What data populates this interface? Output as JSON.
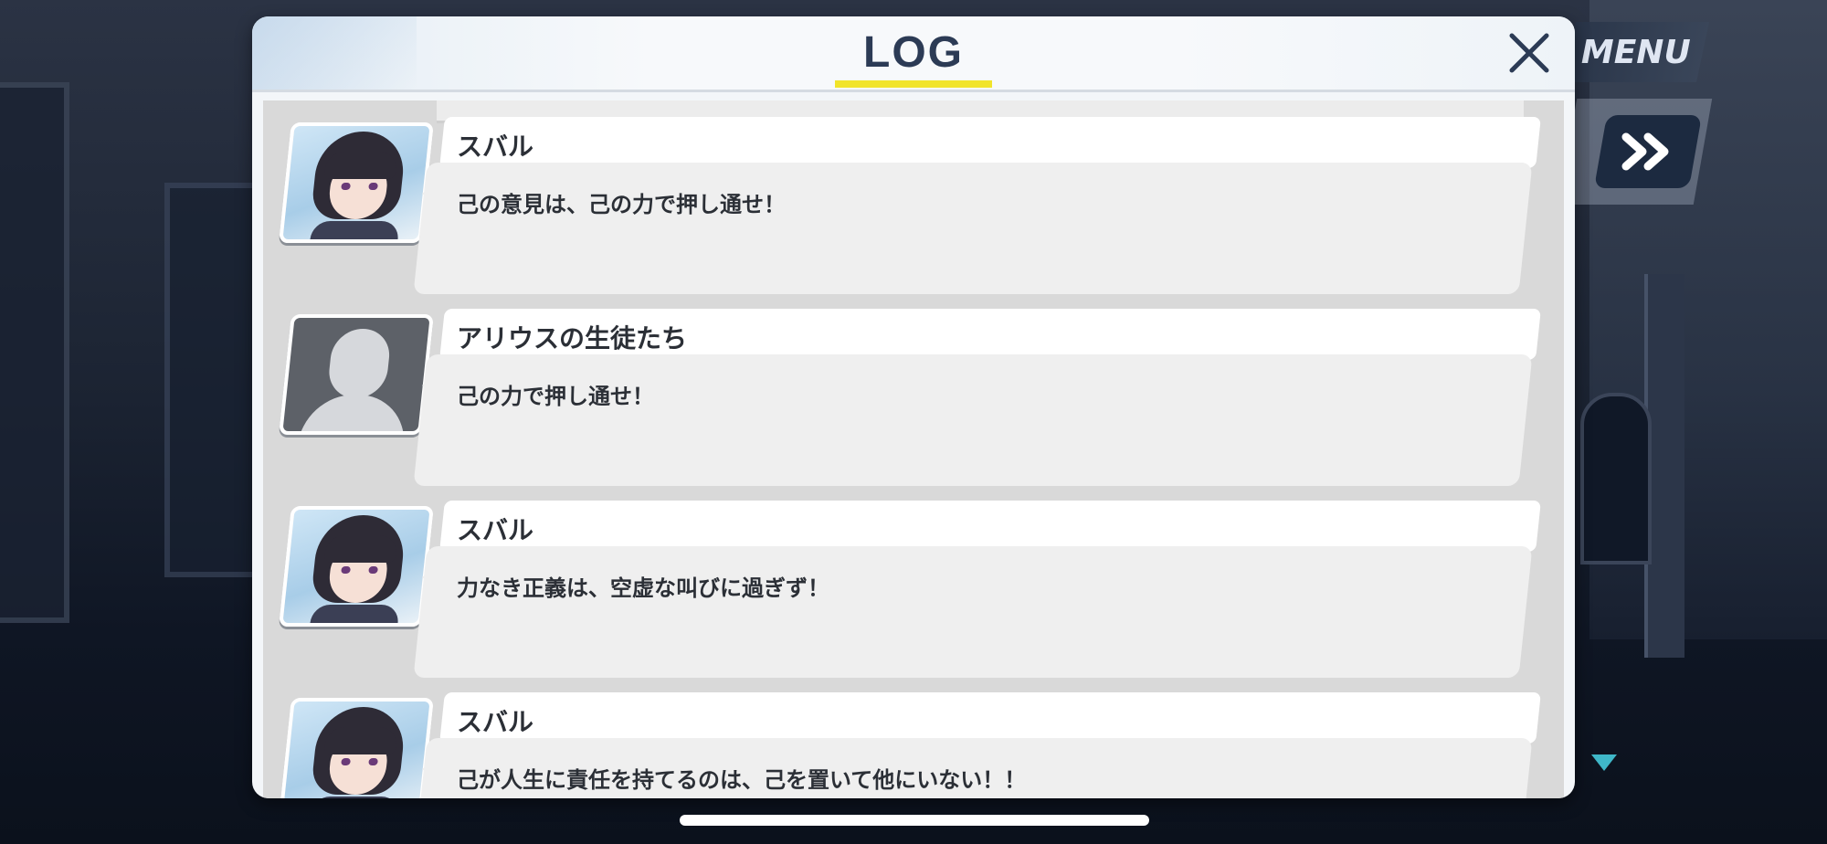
{
  "header": {
    "menu_label": "MENU",
    "title": "LOG",
    "close_icon": "close-icon",
    "fast_forward_icon": "fast-forward-icon"
  },
  "entries": [
    {
      "speaker": "スバル",
      "text": "己の意見は、己の力で押し通せ！",
      "avatar": "character-portrait"
    },
    {
      "speaker": "アリウスの生徒たち",
      "text": "己の力で押し通せ！",
      "avatar": "anonymous-silhouette"
    },
    {
      "speaker": "スバル",
      "text": "力なき正義は、空虚な叫びに過ぎず！",
      "avatar": "character-portrait"
    },
    {
      "speaker": "スバル",
      "text": "己が人生に責任を持てるのは、己を置いて他にいない！！",
      "avatar": "character-portrait"
    }
  ],
  "colors": {
    "accent_underline": "#f1e42a",
    "title_text": "#2c3b55",
    "scroll_indicator": "#3fb7c8"
  }
}
